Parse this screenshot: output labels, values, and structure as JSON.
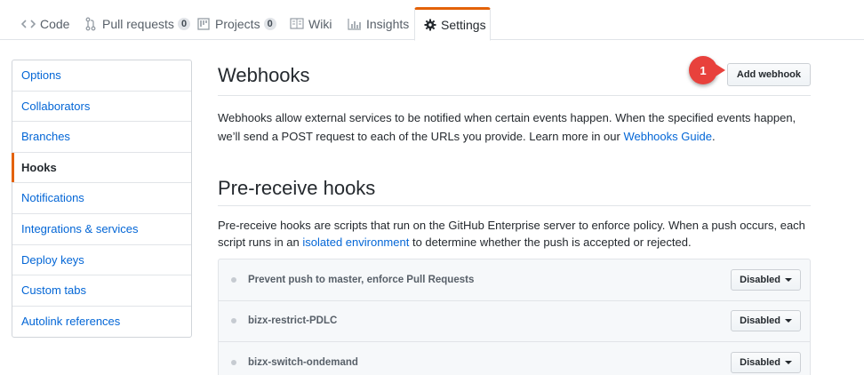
{
  "tabs": [
    {
      "label": "Code",
      "icon": "code-icon"
    },
    {
      "label": "Pull requests",
      "icon": "git-pull-request-icon",
      "count": "0"
    },
    {
      "label": "Projects",
      "icon": "project-icon",
      "count": "0"
    },
    {
      "label": "Wiki",
      "icon": "book-icon"
    },
    {
      "label": "Insights",
      "icon": "graph-icon"
    },
    {
      "label": "Settings",
      "icon": "gear-icon",
      "selected": true
    }
  ],
  "sidebar": {
    "items": [
      {
        "label": "Options"
      },
      {
        "label": "Collaborators"
      },
      {
        "label": "Branches"
      },
      {
        "label": "Hooks",
        "selected": true
      },
      {
        "label": "Notifications"
      },
      {
        "label": "Integrations & services"
      },
      {
        "label": "Deploy keys"
      },
      {
        "label": "Custom tabs"
      },
      {
        "label": "Autolink references"
      }
    ]
  },
  "webhooks": {
    "title": "Webhooks",
    "add_button": "Add webhook",
    "callout_number": "1",
    "description_1": "Webhooks allow external services to be notified when certain events happen. When the specified events happen, we’ll send a POST request to each of the URLs you provide. Learn more in our ",
    "description_link": "Webhooks Guide",
    "description_2": "."
  },
  "pre_receive": {
    "title": "Pre-receive hooks",
    "description_1": "Pre-receive hooks are scripts that run on the GitHub Enterprise server to enforce policy. When a push occurs, each script runs in an ",
    "description_link": "isolated environment",
    "description_2": " to determine whether the push is accepted or rejected.",
    "hooks": [
      {
        "name": "Prevent push to master, enforce Pull Requests",
        "status": "Disabled"
      },
      {
        "name": "bizx-restrict-PDLC",
        "status": "Disabled"
      },
      {
        "name": "bizx-switch-ondemand",
        "status": "Disabled"
      }
    ]
  },
  "colors": {
    "accent": "#e36209",
    "link": "#0366d6",
    "callout": "#e8413c"
  }
}
